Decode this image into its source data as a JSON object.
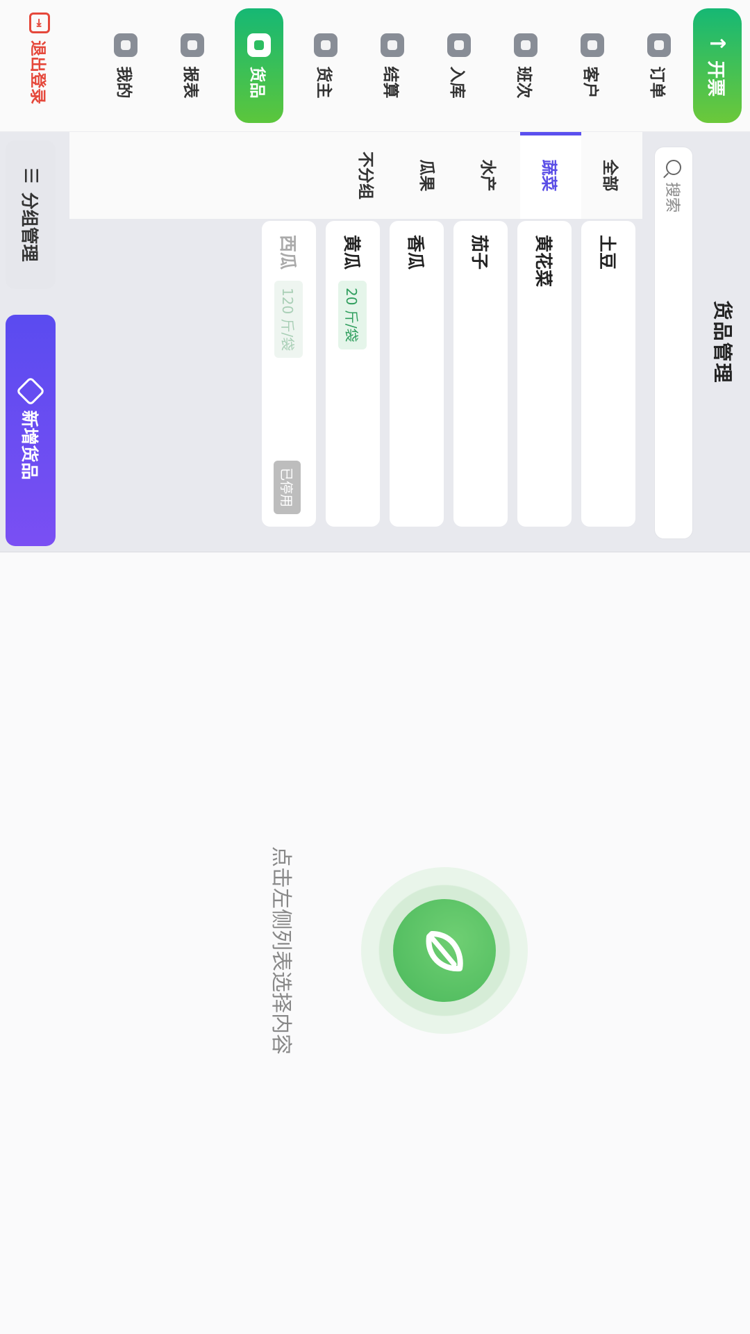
{
  "nav": {
    "invoice_button": "开票",
    "items": [
      {
        "label": "订单",
        "icon": "order-icon"
      },
      {
        "label": "客户",
        "icon": "customer-icon"
      },
      {
        "label": "班次",
        "icon": "shift-icon"
      },
      {
        "label": "入库",
        "icon": "inbound-icon"
      },
      {
        "label": "结算",
        "icon": "settlement-icon"
      },
      {
        "label": "货主",
        "icon": "owner-icon"
      },
      {
        "label": "货品",
        "icon": "goods-icon",
        "active": true
      },
      {
        "label": "报表",
        "icon": "report-icon"
      },
      {
        "label": "我的",
        "icon": "profile-icon"
      }
    ],
    "logout": "退出登录"
  },
  "panel": {
    "title": "货品管理",
    "search_placeholder": "搜索",
    "categories": [
      {
        "label": "全部"
      },
      {
        "label": "蔬菜",
        "active": true
      },
      {
        "label": "水产"
      },
      {
        "label": "瓜果"
      },
      {
        "label": "不分组"
      }
    ],
    "goods": [
      {
        "name": "土豆",
        "spec": "",
        "status": ""
      },
      {
        "name": "黄花菜",
        "spec": "",
        "status": ""
      },
      {
        "name": "茄子",
        "spec": "",
        "status": ""
      },
      {
        "name": "香瓜",
        "spec": "",
        "status": ""
      },
      {
        "name": "黄瓜",
        "spec": "20 斤/袋",
        "status": ""
      },
      {
        "name": "西瓜",
        "spec": "120 斤/袋",
        "status": "已停用"
      }
    ],
    "group_button": "分组管理",
    "add_button": "新增货品"
  },
  "empty_state": {
    "text": "点击左侧列表选择内容"
  },
  "colors": {
    "brand_green": "#16b874",
    "accent_purple": "#5a4bf0",
    "danger_red": "#e5483b"
  }
}
